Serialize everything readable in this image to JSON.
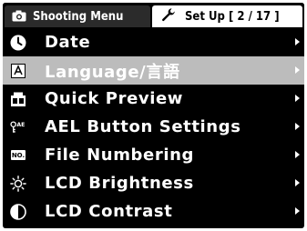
{
  "tabs": {
    "shooting_label": "Shooting Menu",
    "setup_label": "Set Up [ 2 / 17 ]"
  },
  "menu": {
    "items": [
      {
        "label": "Date",
        "icon": "clock-icon"
      },
      {
        "label": "Language/言語",
        "icon": "language-icon",
        "selected": true
      },
      {
        "label": "Quick Preview",
        "icon": "quick-preview-icon"
      },
      {
        "label": "AEL Button Settings",
        "icon": "ael-key-icon"
      },
      {
        "label": "File Numbering",
        "icon": "file-numbering-icon",
        "badge": "NO."
      },
      {
        "label": "LCD Brightness",
        "icon": "brightness-icon"
      },
      {
        "label": "LCD Contrast",
        "icon": "contrast-icon"
      }
    ]
  },
  "colors": {
    "background": "#000000",
    "selected_row": "#bcbcbc",
    "active_tab": "#ffffff",
    "inactive_tab": "#2b2b2b"
  }
}
